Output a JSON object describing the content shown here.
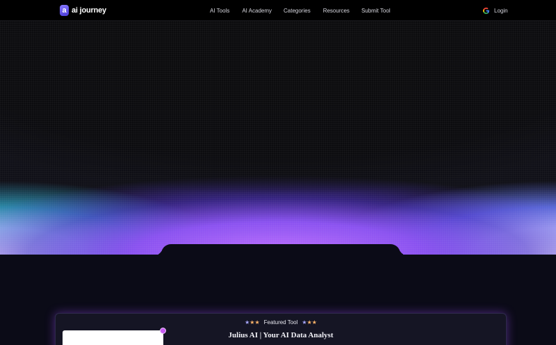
{
  "brand": {
    "mark": "a",
    "name": "ai journey"
  },
  "nav": {
    "items": [
      {
        "label": "AI Tools"
      },
      {
        "label": "AI Academy"
      },
      {
        "label": "Categories"
      },
      {
        "label": "Resources"
      },
      {
        "label": "Submit Tool"
      }
    ],
    "login": {
      "label": "Login",
      "icon": "google-icon"
    }
  },
  "featured": {
    "stars_left": "★★★",
    "stars_right": "★★★",
    "badge": "Featured Tool",
    "title": "Julius AI | Your AI Data Analyst"
  },
  "colors": {
    "accent_purple": "#c070ff",
    "brand_blue": "#6a5bff",
    "background": "#0b0b17"
  }
}
